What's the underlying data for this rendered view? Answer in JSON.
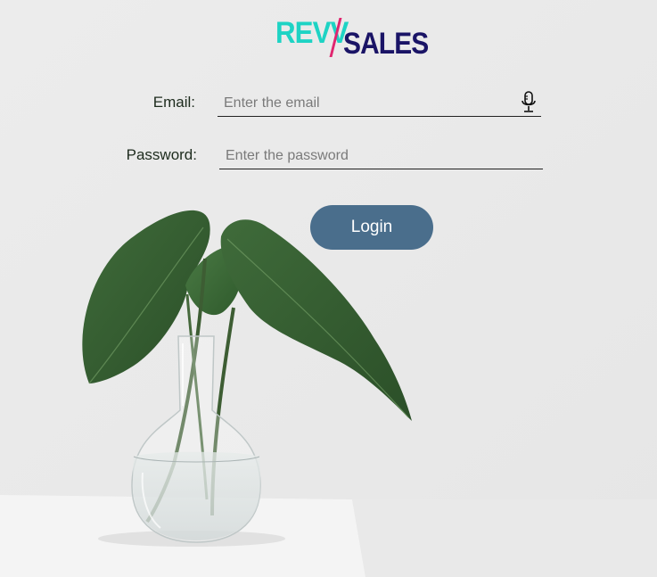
{
  "brand": {
    "logo_part1": "REVV",
    "logo_part2": "SALES",
    "colors": {
      "revv": "#1ed3c4",
      "slash": "#e0266f",
      "sales": "#1a1466"
    }
  },
  "form": {
    "email": {
      "label": "Email:",
      "placeholder": "Enter the email",
      "value": "",
      "icon": "microphone-icon"
    },
    "password": {
      "label": "Password:",
      "placeholder": "Enter the password",
      "value": ""
    },
    "login_label": "Login",
    "accent": "#4a6e8c"
  },
  "background": {
    "image": "plant-in-glass-vase"
  }
}
